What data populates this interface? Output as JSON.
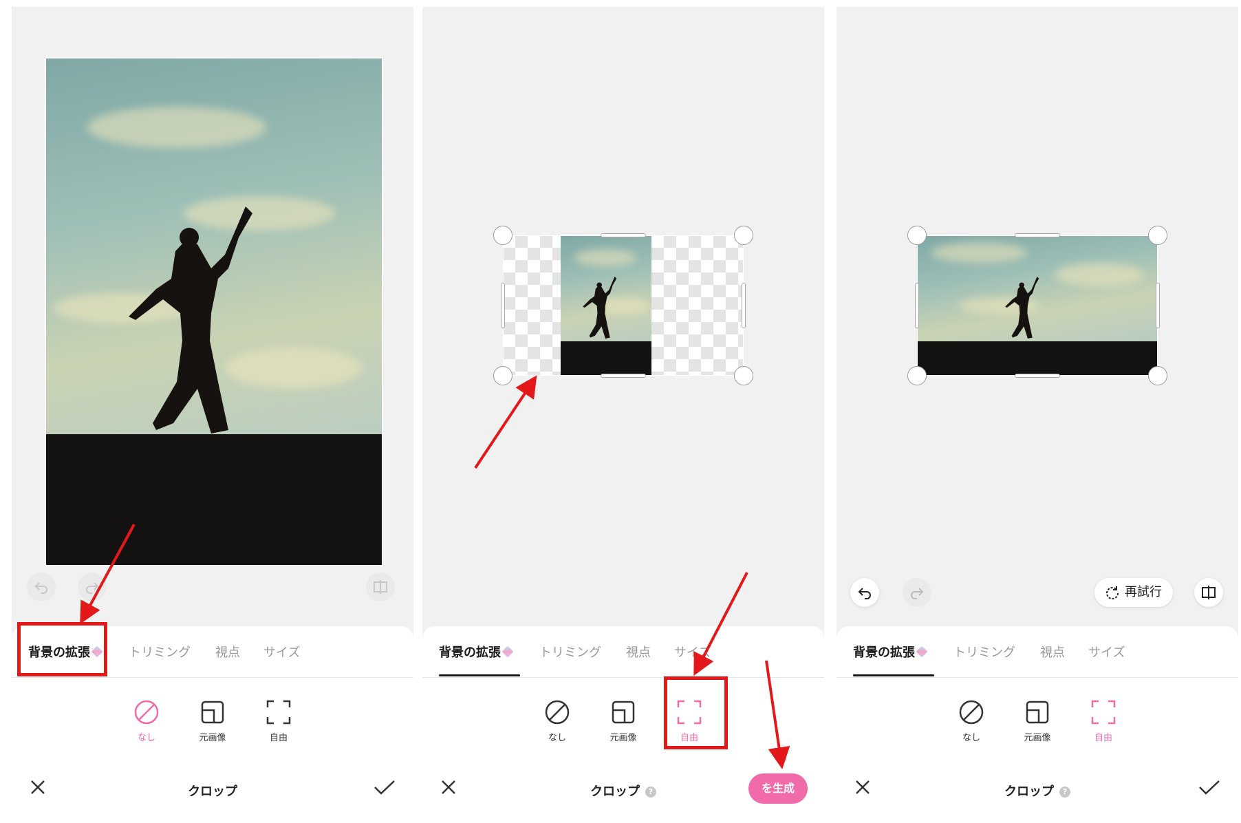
{
  "colors": {
    "accent_pink": "#f06ba8",
    "annotation_red": "#e3181b",
    "panel_bg": "#f1f1f1"
  },
  "panels": [
    {
      "tabs": [
        {
          "label": "背景の拡張",
          "premium": true,
          "active": true
        },
        {
          "label": "トリミング"
        },
        {
          "label": "視点"
        },
        {
          "label": "サイズ"
        }
      ],
      "options": [
        {
          "label": "なし",
          "icon": "none-icon",
          "selected": true
        },
        {
          "label": "元画像",
          "icon": "original-image-icon",
          "selected": false
        },
        {
          "label": "自由",
          "icon": "free-crop-icon",
          "selected": false
        }
      ],
      "title": "クロップ",
      "close_icon": "close-icon",
      "confirm_icon": "check-icon"
    },
    {
      "tabs": [
        {
          "label": "背景の拡張",
          "premium": true,
          "active": true
        },
        {
          "label": "トリミング"
        },
        {
          "label": "視点"
        },
        {
          "label": "サイズ"
        }
      ],
      "options": [
        {
          "label": "なし",
          "icon": "none-icon",
          "selected": false
        },
        {
          "label": "元画像",
          "icon": "original-image-icon",
          "selected": false
        },
        {
          "label": "自由",
          "icon": "free-crop-icon",
          "selected": true
        }
      ],
      "title": "クロップ",
      "help": "?",
      "generate_label": "を生成",
      "close_icon": "close-icon"
    },
    {
      "tabs": [
        {
          "label": "背景の拡張",
          "premium": true,
          "active": true
        },
        {
          "label": "トリミング"
        },
        {
          "label": "視点"
        },
        {
          "label": "サイズ"
        }
      ],
      "options": [
        {
          "label": "なし",
          "icon": "none-icon",
          "selected": false
        },
        {
          "label": "元画像",
          "icon": "original-image-icon",
          "selected": false
        },
        {
          "label": "自由",
          "icon": "free-crop-icon",
          "selected": true
        }
      ],
      "title": "クロップ",
      "help": "?",
      "retry_label": "再試行",
      "close_icon": "close-icon",
      "confirm_icon": "check-icon"
    }
  ]
}
